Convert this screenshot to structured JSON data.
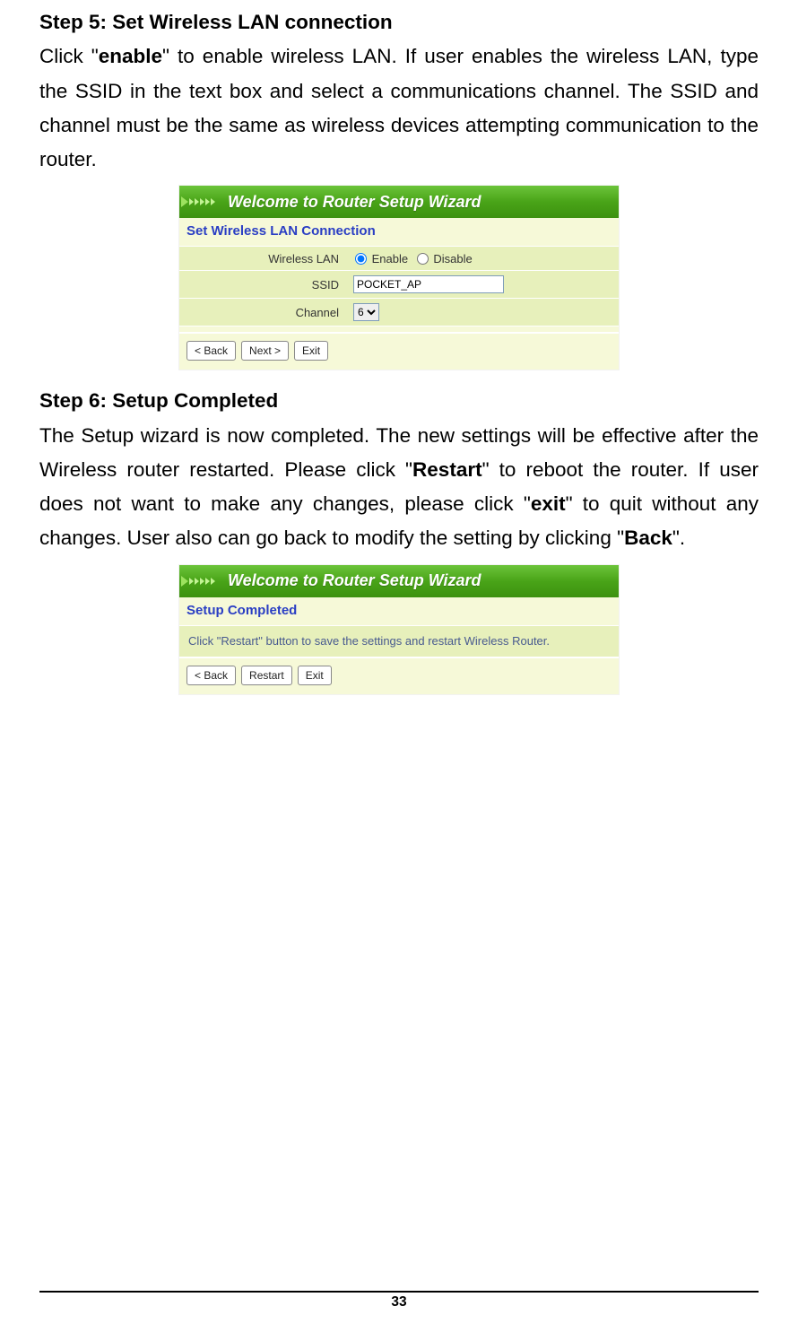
{
  "step5": {
    "heading": "Step 5: Set Wireless LAN connection",
    "para_pre": "Click \"",
    "enable_word": "enable",
    "para_post": "\" to enable wireless LAN. If user enables the wireless LAN, type the SSID in the text box and select a communications channel. The SSID and channel must be the same as wireless devices attempting communication to the router."
  },
  "wizard_header_title": "Welcome to Router Setup Wizard",
  "wlan_panel": {
    "section_title": "Set Wireless LAN Connection",
    "row_wlan_label": "Wireless LAN",
    "enable_label": "Enable",
    "disable_label": "Disable",
    "row_ssid_label": "SSID",
    "ssid_value": "POCKET_AP",
    "row_channel_label": "Channel",
    "channel_value": "6",
    "back_btn": "< Back",
    "next_btn": "Next >",
    "exit_btn": "Exit"
  },
  "step6": {
    "heading": "Step 6: Setup Completed",
    "p1_a": "The Setup wizard is now completed. The new settings will be effective after the Wireless router restarted.   Please click \"",
    "restart_word": "Restart",
    "p1_b": "\" to reboot the router.   If user does not want to make any changes, please click \"",
    "exit_word": "exit",
    "p1_c": "\" to quit without any changes.    User also can go back to modify the setting by clicking \"",
    "back_word": "Back",
    "p1_d": "\"."
  },
  "completed_panel": {
    "section_title": "Setup Completed",
    "desc": "Click \"Restart\" button to save the settings and restart Wireless Router.",
    "back_btn": "< Back",
    "restart_btn": "Restart",
    "exit_btn": "Exit"
  },
  "page_number": "33"
}
